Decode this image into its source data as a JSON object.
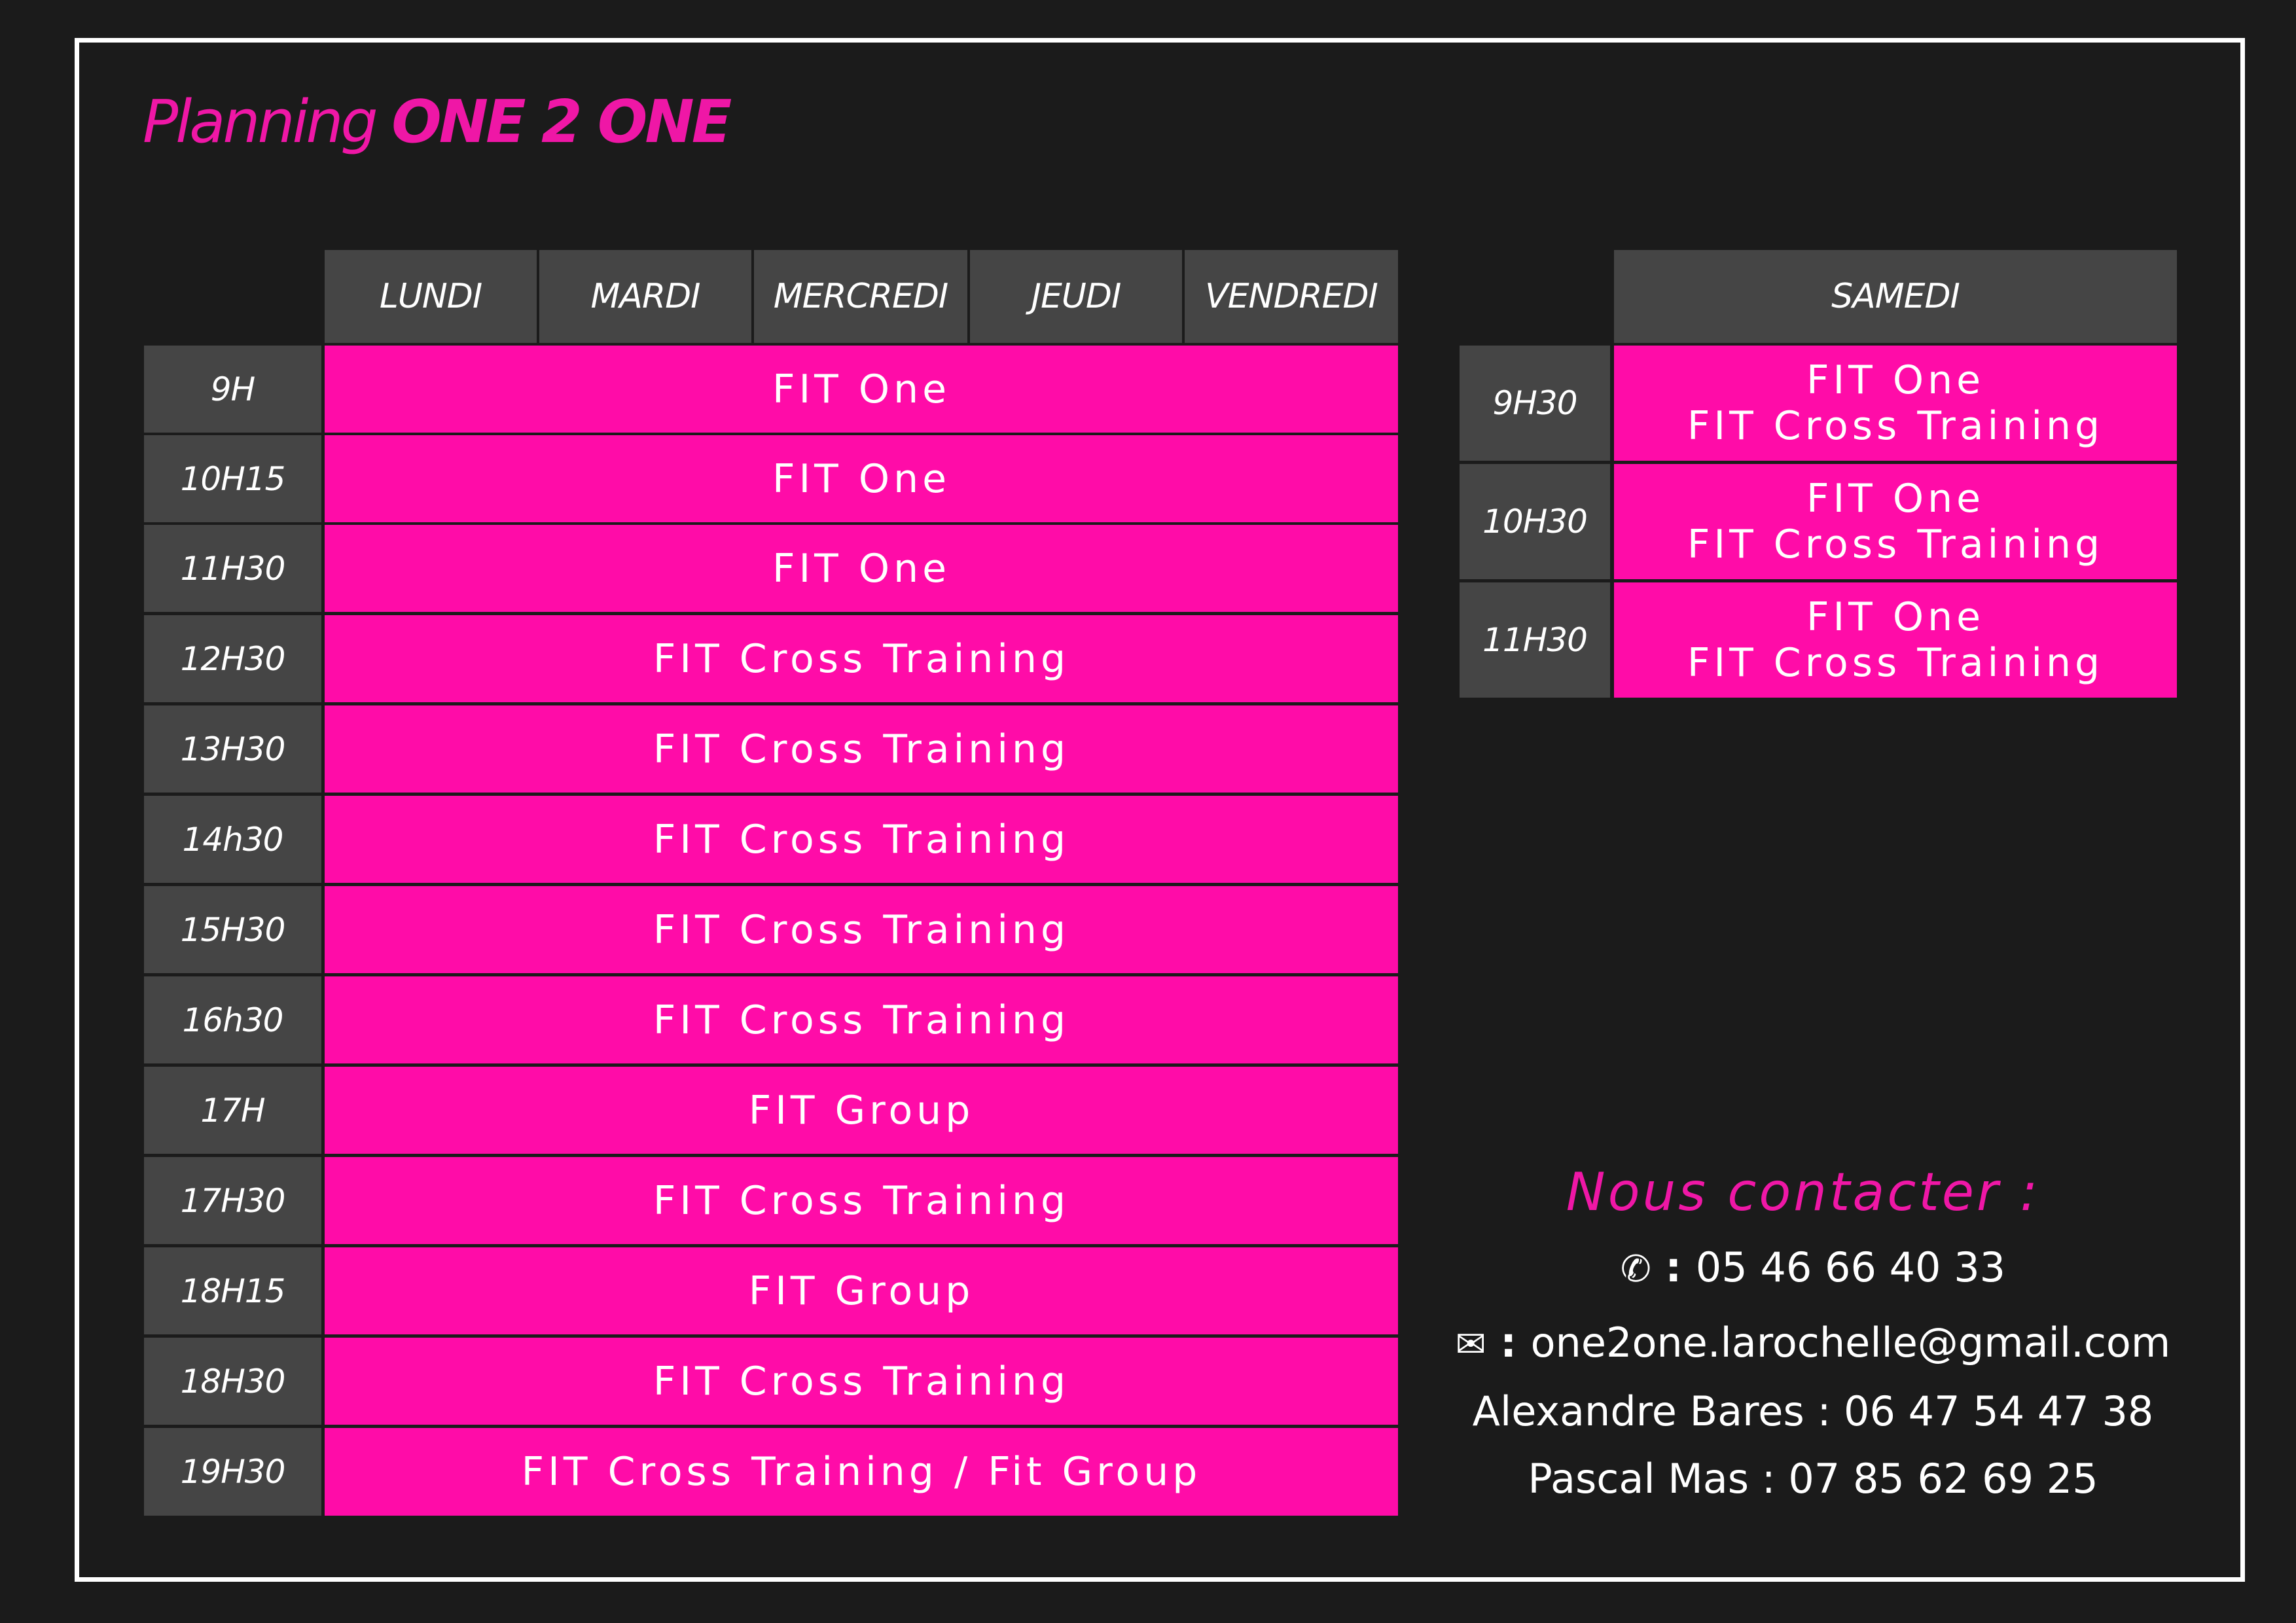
{
  "title": {
    "regular": "Planning ",
    "bold": "ONE 2 ONE"
  },
  "weekdays": [
    "LUNDI",
    "MARDI",
    "MERCREDI",
    "JEUDI",
    "VENDREDI"
  ],
  "weekday_rows": [
    {
      "time": "9H",
      "activity": "FIT One"
    },
    {
      "time": "10H15",
      "activity": "FIT One"
    },
    {
      "time": "11H30",
      "activity": "FIT One"
    },
    {
      "time": "12H30",
      "activity": "FIT Cross Training"
    },
    {
      "time": "13H30",
      "activity": "FIT Cross Training"
    },
    {
      "time": "14h30",
      "activity": "FIT Cross Training"
    },
    {
      "time": "15H30",
      "activity": "FIT Cross Training"
    },
    {
      "time": "16h30",
      "activity": "FIT Cross Training"
    },
    {
      "time": "17H",
      "activity": "FIT Group"
    },
    {
      "time": "17H30",
      "activity": "FIT Cross Training"
    },
    {
      "time": "18H15",
      "activity": "FIT Group"
    },
    {
      "time": "18H30",
      "activity": "FIT Cross Training"
    },
    {
      "time": "19H30",
      "activity": "FIT Cross Training / Fit Group"
    }
  ],
  "saturday": {
    "header": "SAMEDI",
    "rows": [
      {
        "time": "9H30",
        "line1": "FIT One",
        "line2": "FIT Cross Training"
      },
      {
        "time": "10H30",
        "line1": "FIT One",
        "line2": "FIT Cross Training"
      },
      {
        "time": "11H30",
        "line1": "FIT One",
        "line2": "FIT Cross Training"
      }
    ]
  },
  "contact": {
    "title": "Nous contacter :",
    "phone_icon": "phone-icon",
    "phone_sep": " : ",
    "phone": "05 46 66 40 33",
    "email_icon": "envelope-icon",
    "email_sep": " : ",
    "email": "one2one.larochelle@gmail.com",
    "person1": "Alexandre Bares : 06 47 54 47 38",
    "person2": "Pascal Mas : 07 85 62 69 25"
  },
  "colors": {
    "background": "#1b1b1b",
    "accent": "#ff0ca8",
    "header_gray": "#454545",
    "frame": "#ffffff"
  }
}
